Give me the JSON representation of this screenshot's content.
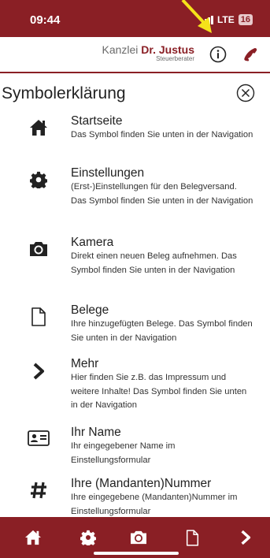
{
  "status_bar": {
    "time": "09:44",
    "network": "LTE",
    "battery": "16"
  },
  "header": {
    "brand_prefix": "Kanzlei ",
    "brand_name": "Dr. Justus",
    "brand_subtitle": "Steuerberater",
    "info_icon": "info-icon",
    "phone_icon": "phone-icon"
  },
  "panel": {
    "title": "Symbolerklärung",
    "close_icon": "close-circle-icon",
    "items": [
      {
        "icon": "home-icon",
        "title": "Startseite",
        "description": "Das Symbol finden Sie unten in der Navigation"
      },
      {
        "icon": "gear-icon",
        "title": "Einstellungen",
        "description": "(Erst-)Einstellungen für den Belegversand. Das Symbol finden Sie unten in der Navigation"
      },
      {
        "icon": "camera-icon",
        "title": "Kamera",
        "description": "Direkt einen neuen Beleg aufnehmen. Das Symbol finden Sie unten in der Navigation"
      },
      {
        "icon": "document-icon",
        "title": "Belege",
        "description": "Ihre hinzugefügten Belege. Das Symbol finden Sie unten in der Navigation"
      },
      {
        "icon": "chevron-right-icon",
        "title": "Mehr",
        "description": "Hier finden Sie z.B. das Impressum und weitere Inhalte! Das Symbol finden Sie unten in der Navigation"
      },
      {
        "icon": "id-card-icon",
        "title": "Ihr Name",
        "description": "Ihr eingegebener Name im Einstellungsformular"
      },
      {
        "icon": "hashtag-icon",
        "title": "Ihre (Mandanten)Nummer",
        "description": "Ihre eingegebene (Mandanten)Nummer im Einstellungsformular"
      }
    ]
  },
  "bottom_nav": {
    "items": [
      "home-icon",
      "gear-icon",
      "camera-icon",
      "document-icon",
      "chevron-right-icon"
    ]
  },
  "colors": {
    "brand": "#8a1f25",
    "annotation_arrow": "#f5e21a"
  }
}
